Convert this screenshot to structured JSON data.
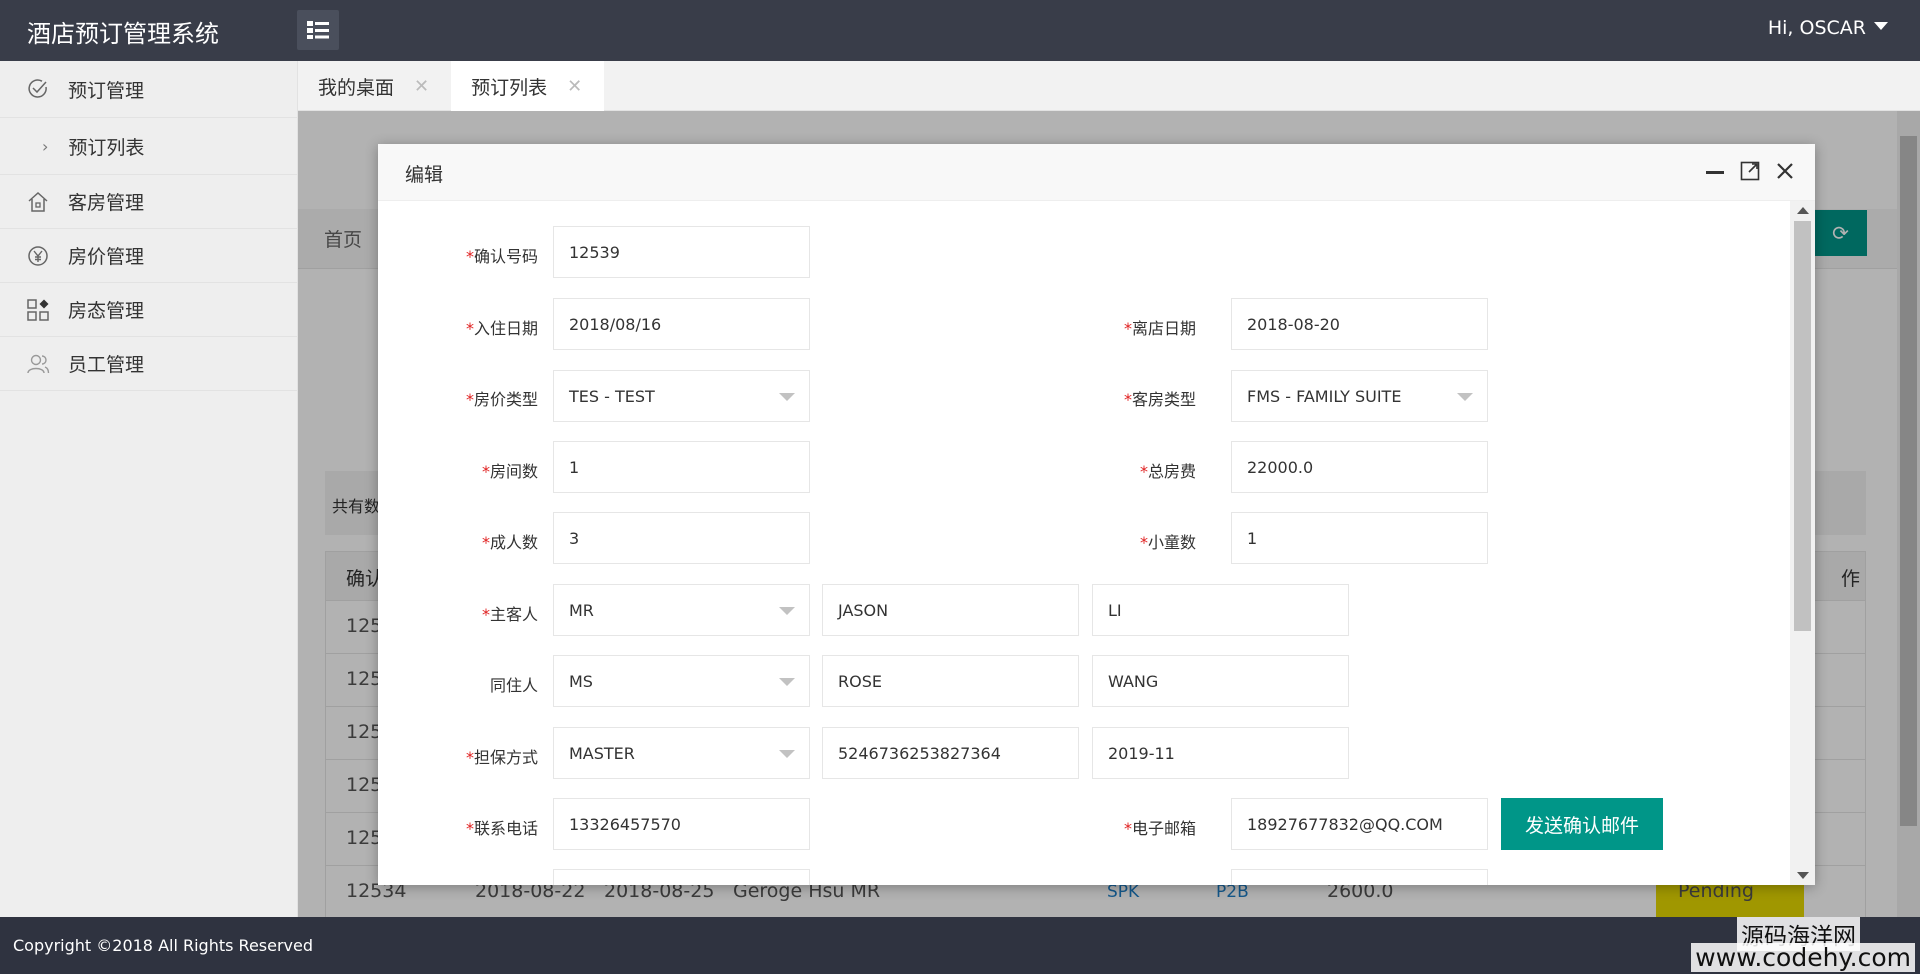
{
  "app": {
    "title": "酒店预订管理系统",
    "user_greeting": "Hi, OSCAR"
  },
  "sidebar": {
    "items": [
      {
        "label": "预订管理",
        "icon": "check-circle-icon"
      },
      {
        "label": "预订列表",
        "icon": "chevron-right-icon"
      },
      {
        "label": "客房管理",
        "icon": "home-icon"
      },
      {
        "label": "房价管理",
        "icon": "yen-icon"
      },
      {
        "label": "房态管理",
        "icon": "grid-icon"
      },
      {
        "label": "员工管理",
        "icon": "users-icon"
      }
    ]
  },
  "tabs": [
    {
      "label": "我的桌面"
    },
    {
      "label": "预订列表"
    }
  ],
  "background": {
    "breadcrumb": "首页",
    "count_text": "共有数",
    "header_first": "确认",
    "header_last": "作",
    "row_prefixes": [
      "125",
      "125",
      "125",
      "125",
      "125"
    ],
    "last_row": {
      "id": "12534",
      "arrival": "2018-08-22",
      "departure": "2018-08-25",
      "guest": "Geroge Hsu MR",
      "rate": "SPK",
      "room": "P2B",
      "amount": "2600.0",
      "status": "Pending"
    }
  },
  "modal": {
    "title": "编辑",
    "fields": {
      "confirm_no": {
        "label": "确认号码",
        "value": "12539"
      },
      "arrival": {
        "label": "入住日期",
        "value": "2018/08/16"
      },
      "departure": {
        "label": "离店日期",
        "value": "2018-08-20"
      },
      "rate_type": {
        "label": "房价类型",
        "value": "TES - TEST"
      },
      "room_type": {
        "label": "客房类型",
        "value": "FMS - FAMILY SUITE"
      },
      "rooms": {
        "label": "房间数",
        "value": "1"
      },
      "total": {
        "label": "总房费",
        "value": "22000.0"
      },
      "adults": {
        "label": "成人数",
        "value": "3"
      },
      "children": {
        "label": "小童数",
        "value": "1"
      },
      "main_guest": {
        "label": "主客人",
        "title": "MR",
        "first": "JASON",
        "last": "LI"
      },
      "companion": {
        "label": "同住人",
        "title": "MS",
        "first": "ROSE",
        "last": "WANG"
      },
      "guarantee": {
        "label": "担保方式",
        "method": "MASTER",
        "card": "5246736253827364",
        "expiry": "2019-11"
      },
      "phone": {
        "label": "联系电话",
        "value": "13326457570"
      },
      "email": {
        "label": "电子邮箱",
        "value": "18927677832@QQ.COM"
      }
    },
    "send_button": "发送确认邮件"
  },
  "footer": {
    "copyright": "Copyright ©2018 All Rights Reserved",
    "watermark_top": "源码海洋网",
    "watermark_bottom": "www.codehy.com"
  },
  "colors": {
    "topbar": "#393d49",
    "accent": "#009688",
    "pending": "#e6d800",
    "required": "#e02020"
  }
}
